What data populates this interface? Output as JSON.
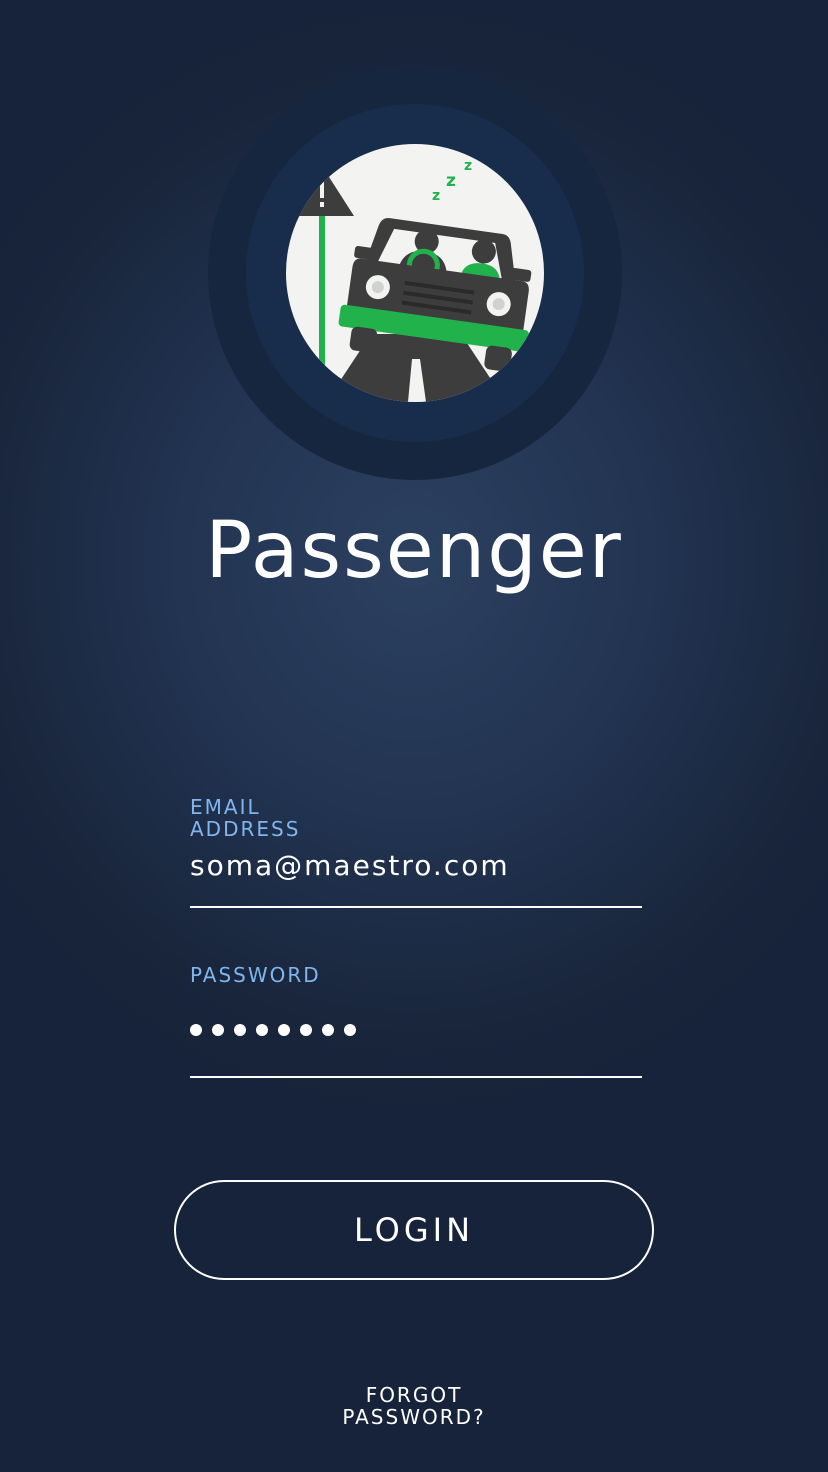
{
  "app": {
    "title": "Passenger",
    "logo_icon": "drowsy-driver-car-icon"
  },
  "login_form": {
    "email_label": "EMAIL ADDRESS",
    "email_value": "soma@maestro.com",
    "password_label": "PASSWORD",
    "password_masked_length": 8,
    "login_button_label": "LOGIN",
    "forgot_password_label": "FORGOT PASSWORD?"
  },
  "colors": {
    "background": "#223452",
    "label_accent": "#7fb6f0",
    "text": "#ffffff",
    "logo_green": "#22b24c",
    "logo_dark": "#3d3d3d"
  }
}
